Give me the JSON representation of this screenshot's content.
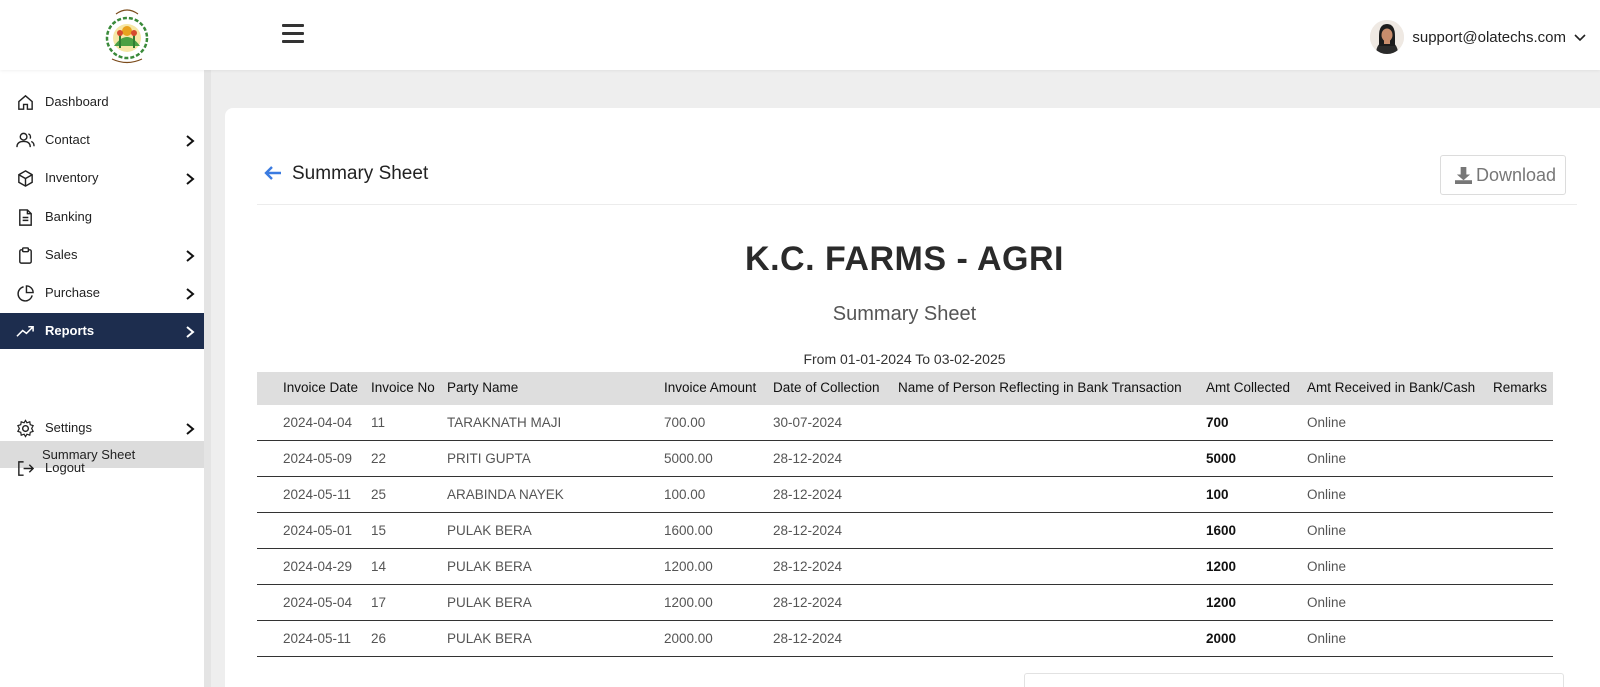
{
  "header": {
    "user_email": "support@olatechs.com"
  },
  "sidebar": {
    "items": [
      {
        "label": "Dashboard",
        "icon": "home-icon"
      },
      {
        "label": "Contact",
        "icon": "users-icon"
      },
      {
        "label": "Inventory",
        "icon": "box-icon"
      },
      {
        "label": "Banking",
        "icon": "document-icon"
      },
      {
        "label": "Sales",
        "icon": "clipboard-icon"
      },
      {
        "label": "Purchase",
        "icon": "pie-chart-icon"
      },
      {
        "label": "Reports",
        "icon": "trending-up-icon"
      },
      {
        "label": "Settings",
        "icon": "gear-icon"
      },
      {
        "label": "Logout",
        "icon": "logout-icon"
      }
    ],
    "sub_item": "Summary Sheet",
    "active": "Reports"
  },
  "page": {
    "heading": "Summary Sheet",
    "download_label": "Download",
    "company_name": "K.C. FARMS - AGRI",
    "subtitle": "Summary Sheet",
    "date_range": "From 01-01-2024 To 03-02-2025"
  },
  "table": {
    "columns": [
      "Invoice Date",
      "Invoice No",
      "Party Name",
      "Invoice Amount",
      "Date of Collection",
      "Name of Person Reflecting in Bank Transaction",
      "Amt Collected",
      "Amt Received in Bank/Cash",
      "Remarks"
    ],
    "rows": [
      [
        "2024-04-04",
        "11",
        "TARAKNATH MAJI",
        "700.00",
        "30-07-2024",
        "",
        "700",
        "Online",
        ""
      ],
      [
        "2024-05-09",
        "22",
        "PRITI GUPTA",
        "5000.00",
        "28-12-2024",
        "",
        "5000",
        "Online",
        ""
      ],
      [
        "2024-05-11",
        "25",
        "ARABINDA NAYEK",
        "100.00",
        "28-12-2024",
        "",
        "100",
        "Online",
        ""
      ],
      [
        "2024-05-01",
        "15",
        "PULAK BERA",
        "1600.00",
        "28-12-2024",
        "",
        "1600",
        "Online",
        ""
      ],
      [
        "2024-04-29",
        "14",
        "PULAK BERA",
        "1200.00",
        "28-12-2024",
        "",
        "1200",
        "Online",
        ""
      ],
      [
        "2024-05-04",
        "17",
        "PULAK BERA",
        "1200.00",
        "28-12-2024",
        "",
        "1200",
        "Online",
        ""
      ],
      [
        "2024-05-11",
        "26",
        "PULAK BERA",
        "2000.00",
        "28-12-2024",
        "",
        "2000",
        "Online",
        ""
      ]
    ]
  },
  "colors": {
    "active_nav": "#1d2d4e",
    "back_arrow": "#3b7be0"
  }
}
